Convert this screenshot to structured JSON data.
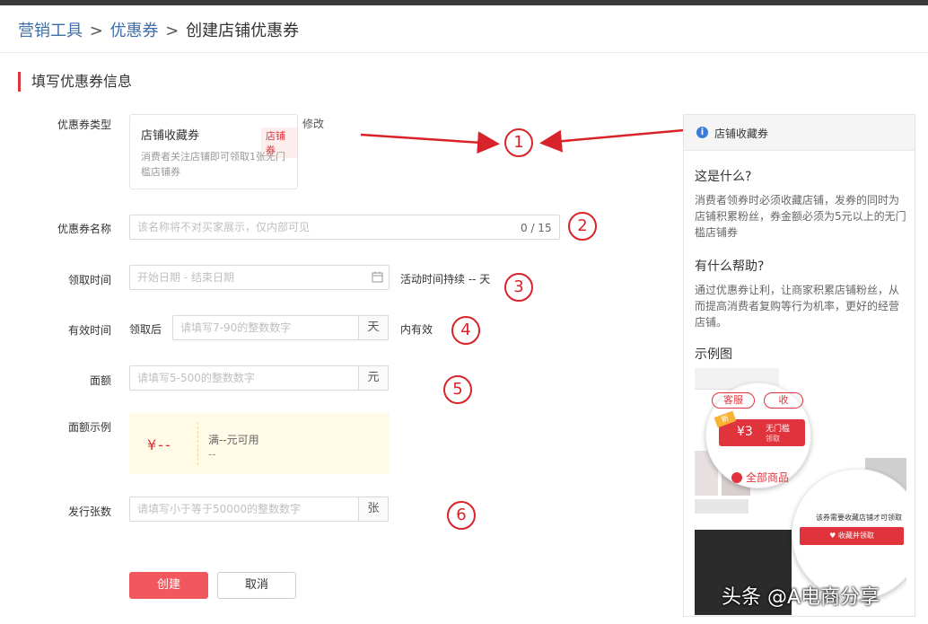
{
  "breadcrumb": {
    "item1": "营销工具",
    "sep1": ">",
    "item2": "优惠券",
    "sep2": ">",
    "current": "创建店铺优惠券"
  },
  "section_title": "填写优惠券信息",
  "form": {
    "type_label": "优惠券类型",
    "type_card": {
      "name": "店铺收藏券",
      "badge": "店铺券",
      "desc": "消费者关注店铺即可领取1张无门槛店铺券"
    },
    "modify_link": "修改",
    "name_label": "优惠券名称",
    "name_placeholder": "该名称将不对买家展示，仅内部可见",
    "name_counter": "0 / 15",
    "time_label": "领取时间",
    "time_placeholder": "开始日期 - 结束日期",
    "time_note": "活动时间持续 -- 天",
    "valid_label": "有效时间",
    "valid_prefix": "领取后",
    "valid_placeholder": "请填写7-90的整数数字",
    "valid_unit": "天",
    "valid_suffix": "内有效",
    "amount_label": "面额",
    "amount_placeholder": "请填写5-500的整数数字",
    "amount_unit": "元",
    "example_label": "面额示例",
    "example": {
      "amount": "¥--",
      "line1": "满--元可用",
      "line2": "--"
    },
    "count_label": "发行张数",
    "count_placeholder": "请填写小于等于50000的整数数字",
    "count_unit": "张",
    "create_button": "创建",
    "cancel_button": "取消"
  },
  "annotations": [
    "1",
    "2",
    "3",
    "4",
    "5",
    "6"
  ],
  "annotation_color": "#d9232a",
  "help": {
    "header": "店铺收藏券",
    "q1": "这是什么?",
    "a1": "消费者领券时必须收藏店铺，发券的同时为店铺积累粉丝，券金额必须为5元以上的无门槛店铺券",
    "q2": "有什么帮助?",
    "a2": "通过优惠券让利，让商家积累店铺粉丝，从而提高消费者复购等行为机率，更好的经营店铺。",
    "q3": "示例图",
    "example_img": {
      "service_btn": "客服",
      "fav_btn": "收",
      "coupon_value": "¥3",
      "coupon_title": "无门槛",
      "coupon_sub": "领取",
      "coupon_tag": "新",
      "all_goods": "全部商品",
      "tip": "该券需要收藏店铺才可领取",
      "fav_button": "♥ 收藏并领取"
    }
  },
  "watermark": "头条 @A电商分享"
}
